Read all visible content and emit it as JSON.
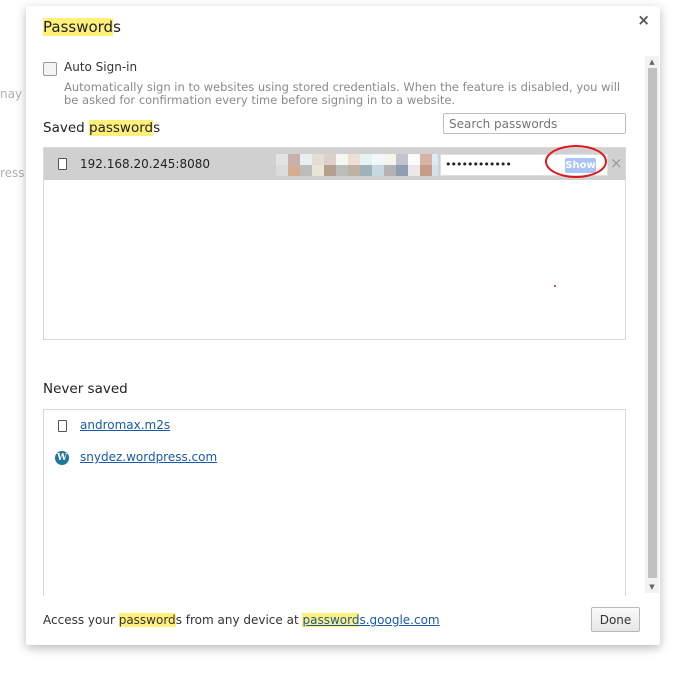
{
  "background": {
    "fragments": [
      "nay o",
      "ress b"
    ]
  },
  "dialog": {
    "title_highlight": "Password",
    "title_rest": "s",
    "close_icon": "×",
    "auto_signin": {
      "label": "Auto Sign-in",
      "checked": false,
      "description": "Automatically sign in to websites using stored credentials. When the feature is disabled, you will be asked for confirmation every time before signing in to a website."
    },
    "saved": {
      "heading_pre": "Saved ",
      "heading_highlight": "password",
      "heading_post": "s",
      "search_placeholder": "Search passwords",
      "rows": [
        {
          "site": "192.168.20.245:8080",
          "username": "(pixelated)",
          "password_mask": "••••••••••••",
          "show_label": "Show",
          "remove_icon": "×"
        }
      ]
    },
    "never_saved": {
      "heading": "Never saved",
      "items": [
        {
          "site": "andromax.m2s",
          "icon": "file-icon"
        },
        {
          "site": "snydez.wordpress.com",
          "icon": "wordpress-icon"
        }
      ]
    },
    "footer": {
      "pre": "Access your ",
      "highlight": "password",
      "mid": "s from any device at ",
      "link_highlight": "password",
      "link_rest": "s.google.com",
      "done_label": "Done"
    },
    "colors": {
      "highlight": "#fff07a",
      "link": "#1a5aa8",
      "annotation_ring": "#e0161b",
      "show_button": "#a9c4f5"
    }
  }
}
